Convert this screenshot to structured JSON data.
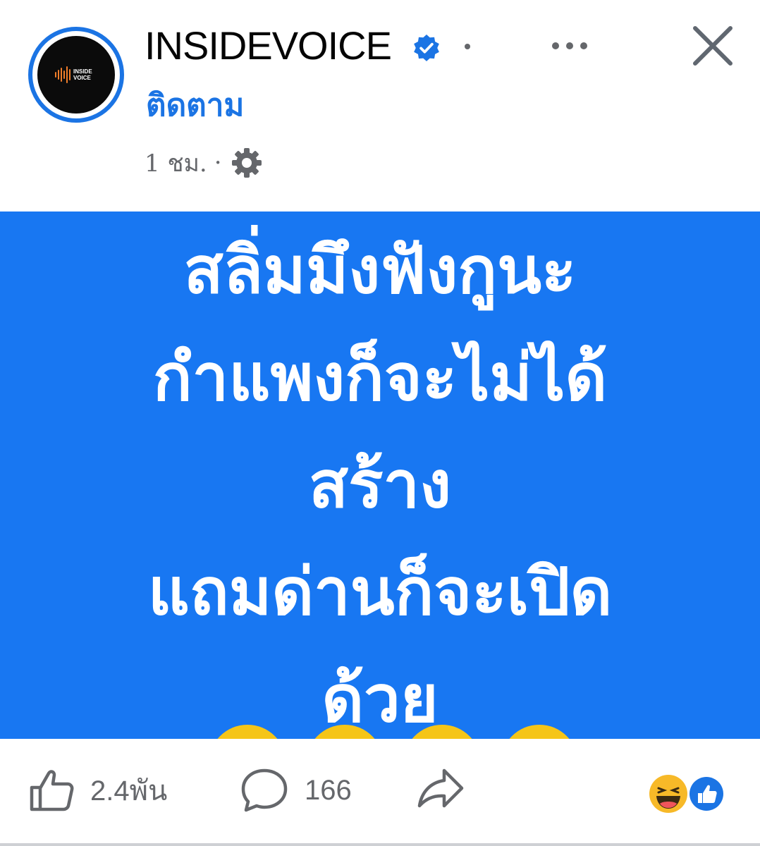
{
  "header": {
    "page_name": "INSIDEVOICE",
    "follow_label": "ติดตาม",
    "timestamp": "1 ชม.",
    "separator": "·",
    "avatar_logo_text": "INSIDE VOICE",
    "icons": {
      "verified": "verified-badge-icon",
      "more": "more-options-icon",
      "close": "close-icon",
      "privacy": "gear-icon"
    }
  },
  "post": {
    "text_lines": [
      "สลิ่มมึงฟังกูนะ",
      "กำแพงก็จะไม่ได้",
      "สร้าง",
      "แถมด่านก็จะเปิด",
      "ด้วย"
    ],
    "background_color": "#1877f2"
  },
  "actions": {
    "like_count": "2.4พัน",
    "comment_count": "166",
    "icons": {
      "like": "thumbs-up-icon",
      "comment": "comment-bubble-icon",
      "share": "share-arrow-icon",
      "reactions": [
        "haha-reaction-icon",
        "like-reaction-icon"
      ]
    }
  },
  "colors": {
    "accent": "#1b74e4",
    "post_bg": "#1877f2",
    "secondary_text": "#65676b"
  }
}
